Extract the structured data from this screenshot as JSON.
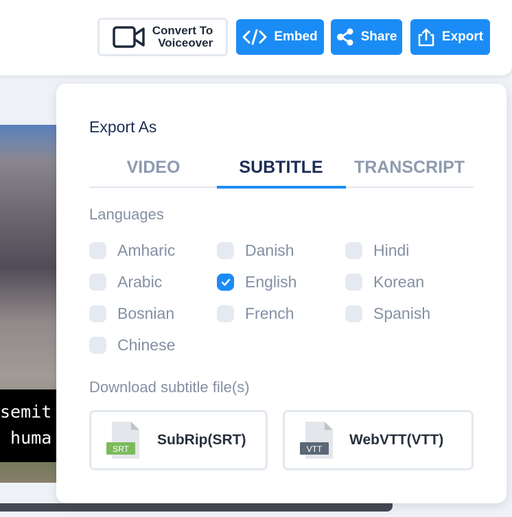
{
  "toolbar": {
    "convert_label_line1": "Convert To",
    "convert_label_line2": "Voiceover",
    "embed_label": "Embed",
    "share_label": "Share",
    "export_label": "Export",
    "accent_color": "#1b8cf5"
  },
  "video": {
    "caption_line1": "semit",
    "caption_line2": " huma"
  },
  "export_panel": {
    "title": "Export As",
    "tabs": [
      {
        "label": "VIDEO",
        "active": false
      },
      {
        "label": "SUBTITLE",
        "active": true
      },
      {
        "label": "TRANSCRIPT",
        "active": false
      }
    ],
    "languages_label": "Languages",
    "languages": [
      {
        "label": "Amharic",
        "checked": false
      },
      {
        "label": "Arabic",
        "checked": false
      },
      {
        "label": "Bosnian",
        "checked": false
      },
      {
        "label": "Chinese",
        "checked": false
      },
      {
        "label": "Danish",
        "checked": false
      },
      {
        "label": "English",
        "checked": true
      },
      {
        "label": "French",
        "checked": false
      },
      {
        "label": "Hindi",
        "checked": false
      },
      {
        "label": "Korean",
        "checked": false
      },
      {
        "label": "Spanish",
        "checked": false
      }
    ],
    "download_label": "Download subtitle file(s)",
    "downloads": [
      {
        "label": "SubRip(SRT)",
        "badge": "SRT",
        "badge_color": "#7cbb5a"
      },
      {
        "label": "WebVTT(VTT)",
        "badge": "VTT",
        "badge_color": "#5a6776"
      }
    ]
  }
}
